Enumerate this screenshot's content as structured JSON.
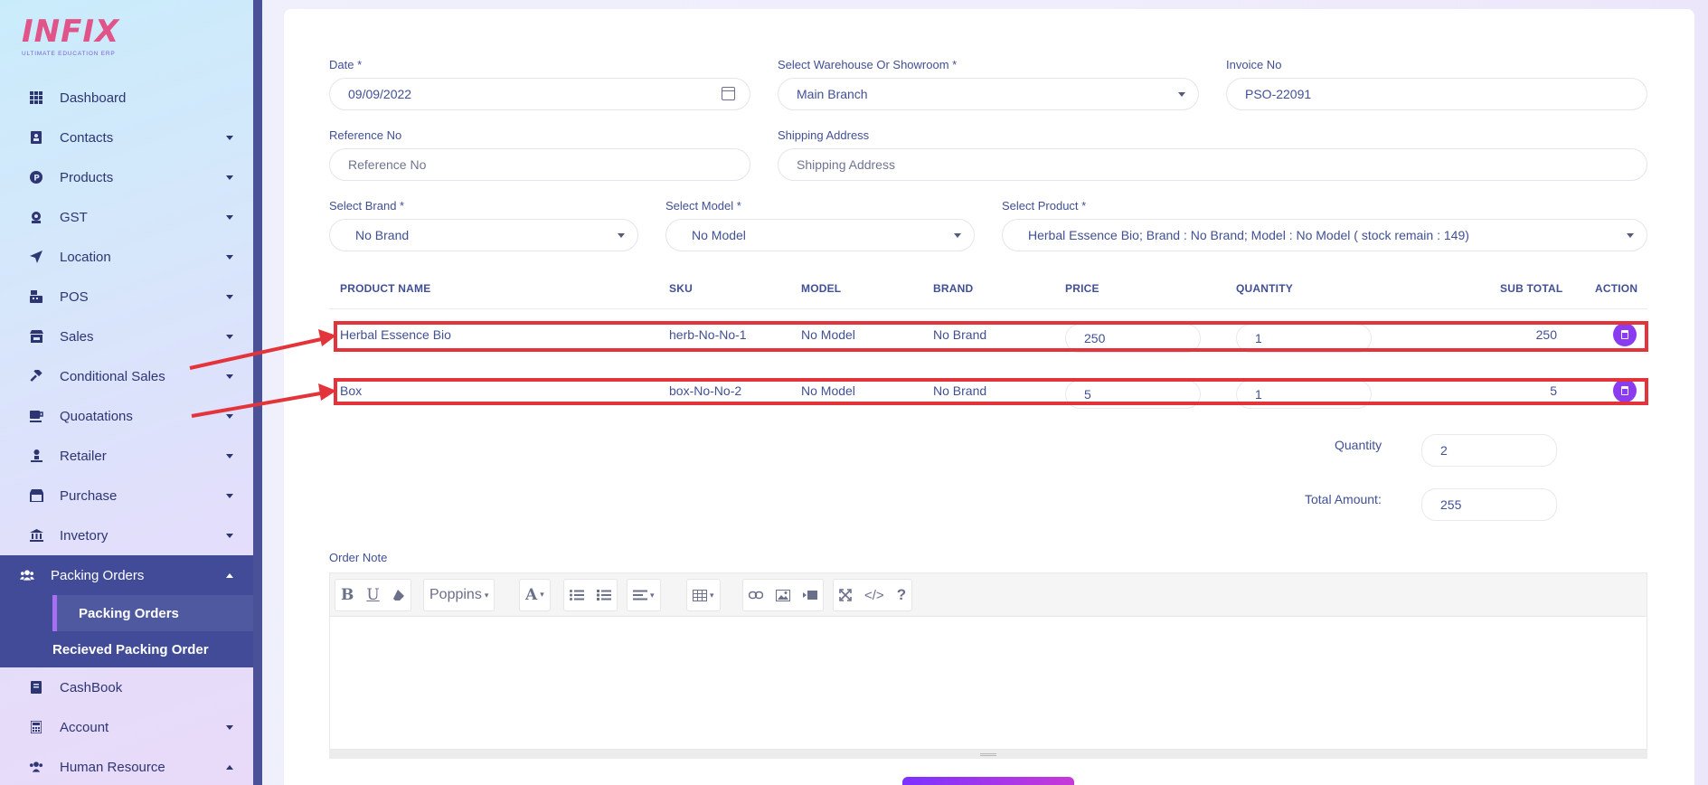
{
  "brand": {
    "logo_text": "INFIX",
    "tagline": "ULTIMATE EDUCATION ERP"
  },
  "sidebar": {
    "items": [
      {
        "label": "Dashboard",
        "icon": "grid-icon",
        "caret": false
      },
      {
        "label": "Contacts",
        "icon": "contacts-icon",
        "caret": true
      },
      {
        "label": "Products",
        "icon": "products-icon",
        "caret": true
      },
      {
        "label": "GST",
        "icon": "gst-icon",
        "caret": true
      },
      {
        "label": "Location",
        "icon": "location-arrow-icon",
        "caret": true
      },
      {
        "label": "POS",
        "icon": "pos-icon",
        "caret": true
      },
      {
        "label": "Sales",
        "icon": "store-icon",
        "caret": true
      },
      {
        "label": "Conditional Sales",
        "icon": "gavel-icon",
        "caret": true
      },
      {
        "label": "Quoatations",
        "icon": "cup-icon",
        "caret": true
      },
      {
        "label": "Retailer",
        "icon": "person-icon",
        "caret": true
      },
      {
        "label": "Purchase",
        "icon": "shop-icon",
        "caret": true
      },
      {
        "label": "Invetory",
        "icon": "bank-icon",
        "caret": true
      }
    ],
    "open_group": {
      "label": "Packing Orders",
      "icon": "users-icon",
      "children": [
        {
          "label": "Packing Orders",
          "selected": true
        },
        {
          "label": "Recieved Packing Order",
          "selected": false
        }
      ]
    },
    "after_items": [
      {
        "label": "CashBook",
        "icon": "book-icon",
        "caret": false
      },
      {
        "label": "Account",
        "icon": "calculator-icon",
        "caret": true
      },
      {
        "label": "Human Resource",
        "icon": "users-icon",
        "caret": true
      }
    ]
  },
  "form": {
    "date": {
      "label": "Date *",
      "value": "09/09/2022"
    },
    "warehouse": {
      "label": "Select Warehouse Or Showroom *",
      "value": "Main Branch"
    },
    "invoice": {
      "label": "Invoice No",
      "value": "PSO-22091"
    },
    "reference": {
      "label": "Reference No",
      "placeholder": "Reference No"
    },
    "shipping": {
      "label": "Shipping Address",
      "placeholder": "Shipping Address"
    },
    "brand": {
      "label": "Select Brand *",
      "value": "No Brand"
    },
    "model": {
      "label": "Select Model *",
      "value": "No Model"
    },
    "product": {
      "label": "Select Product *",
      "value": "Herbal Essence Bio; Brand : No Brand; Model : No Model ( stock remain : 149)"
    }
  },
  "table": {
    "headers": {
      "name": "PRODUCT NAME",
      "sku": "SKU",
      "model": "MODEL",
      "brand": "BRAND",
      "price": "PRICE",
      "quantity": "QUANTITY",
      "subtotal": "SUB TOTAL",
      "action": "ACTION"
    },
    "rows": [
      {
        "name": "Herbal Essence Bio",
        "sku": "herb-No-No-1",
        "model": "No Model",
        "brand": "No Brand",
        "price": "250",
        "quantity": "1",
        "subtotal": "250"
      },
      {
        "name": "Box",
        "sku": "box-No-No-2",
        "model": "No Model",
        "brand": "No Brand",
        "price": "5",
        "quantity": "1",
        "subtotal": "5"
      }
    ]
  },
  "totals": {
    "quantity_label": "Quantity",
    "quantity_value": "2",
    "amount_label": "Total Amount:",
    "amount_value": "255"
  },
  "order_note": {
    "label": "Order Note",
    "font_name": "Poppins"
  },
  "colors": {
    "accent": "#7c32ff",
    "highlight": "#e2343a",
    "sidebar_active": "#414b97"
  }
}
